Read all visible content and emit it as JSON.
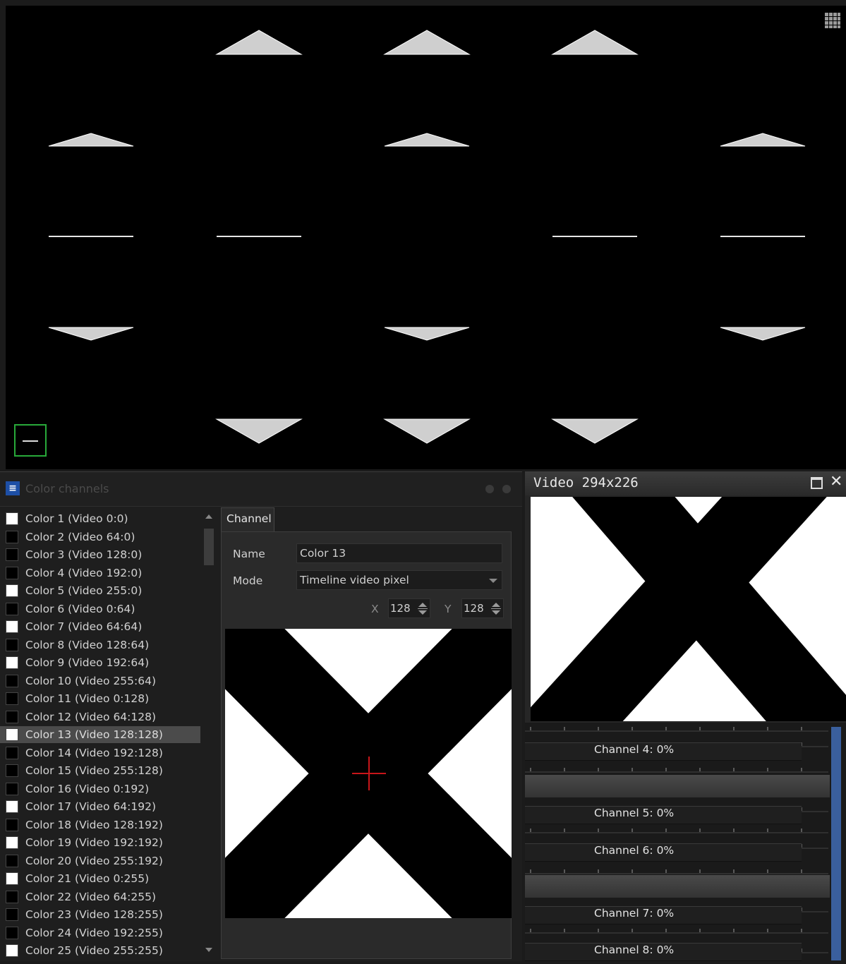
{
  "stage": {
    "grid_icon": "grid-icon",
    "frame_icon": "minus-frame-icon"
  },
  "color_channels": {
    "title": "Color channels",
    "logo_icon": "app-logo-icon",
    "items": [
      {
        "label": "Color 1 (Video 0:0)",
        "swatch": "#ffffff"
      },
      {
        "label": "Color 2 (Video 64:0)",
        "swatch": "#000000"
      },
      {
        "label": "Color 3 (Video 128:0)",
        "swatch": "#000000"
      },
      {
        "label": "Color 4 (Video 192:0)",
        "swatch": "#000000"
      },
      {
        "label": "Color 5 (Video 255:0)",
        "swatch": "#ffffff"
      },
      {
        "label": "Color 6 (Video 0:64)",
        "swatch": "#000000"
      },
      {
        "label": "Color 7 (Video 64:64)",
        "swatch": "#ffffff"
      },
      {
        "label": "Color 8 (Video 128:64)",
        "swatch": "#000000"
      },
      {
        "label": "Color 9 (Video 192:64)",
        "swatch": "#ffffff"
      },
      {
        "label": "Color 10 (Video 255:64)",
        "swatch": "#000000"
      },
      {
        "label": "Color 11 (Video 0:128)",
        "swatch": "#000000"
      },
      {
        "label": "Color 12 (Video 64:128)",
        "swatch": "#000000"
      },
      {
        "label": "Color 13 (Video 128:128)",
        "swatch": "#ffffff"
      },
      {
        "label": "Color 14 (Video 192:128)",
        "swatch": "#000000"
      },
      {
        "label": "Color 15 (Video 255:128)",
        "swatch": "#000000"
      },
      {
        "label": "Color 16 (Video 0:192)",
        "swatch": "#000000"
      },
      {
        "label": "Color 17 (Video 64:192)",
        "swatch": "#ffffff"
      },
      {
        "label": "Color 18 (Video 128:192)",
        "swatch": "#000000"
      },
      {
        "label": "Color 19 (Video 192:192)",
        "swatch": "#ffffff"
      },
      {
        "label": "Color 20 (Video 255:192)",
        "swatch": "#000000"
      },
      {
        "label": "Color 21 (Video 0:255)",
        "swatch": "#ffffff"
      },
      {
        "label": "Color 22 (Video 64:255)",
        "swatch": "#000000"
      },
      {
        "label": "Color 23 (Video 128:255)",
        "swatch": "#000000"
      },
      {
        "label": "Color 24 (Video 192:255)",
        "swatch": "#000000"
      },
      {
        "label": "Color 25 (Video 255:255)",
        "swatch": "#ffffff"
      }
    ],
    "selected_index": 12
  },
  "channel_editor": {
    "tab_label": "Channel",
    "name_label": "Name",
    "name_value": "Color 13",
    "mode_label": "Mode",
    "mode_value": "Timeline video pixel",
    "x_label": "X",
    "x_value": "128",
    "y_label": "Y",
    "y_value": "128",
    "crosshair_color": "#c8161a"
  },
  "video_window": {
    "title": "Video 294x226",
    "maximize_icon": "maximize-icon",
    "close_icon": "close-icon",
    "close_glyph": "✕"
  },
  "channel_meters": [
    {
      "label": "Channel 4: 0%",
      "value": 0
    },
    {
      "label": "Channel 5: 0%",
      "value": 0
    },
    {
      "label": "Channel 6: 0%",
      "value": 0
    },
    {
      "label": "Channel 7: 0%",
      "value": 0
    },
    {
      "label": "Channel 8: 0%",
      "value": 0
    }
  ]
}
